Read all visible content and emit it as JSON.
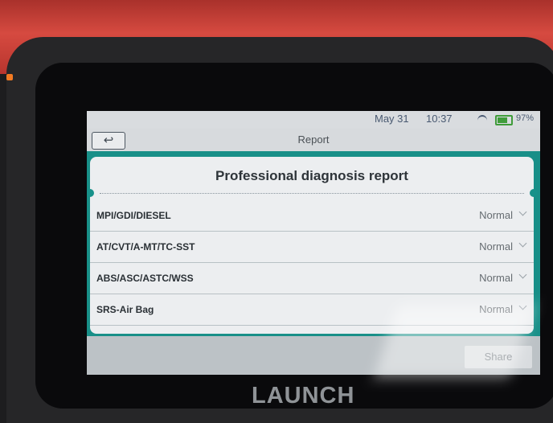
{
  "status": {
    "date": "May 31",
    "time": "10:37",
    "battery": "97%"
  },
  "header": {
    "back_icon": "back-arrow-icon",
    "title": "Report"
  },
  "report": {
    "title": "Professional diagnosis report",
    "rows": [
      {
        "label": "MPI/GDI/DIESEL",
        "value": "Normal"
      },
      {
        "label": "AT/CVT/A-MT/TC-SST",
        "value": "Normal"
      },
      {
        "label": "ABS/ASC/ASTC/WSS",
        "value": "Normal"
      },
      {
        "label": "SRS-Air Bag",
        "value": "Normal"
      }
    ]
  },
  "footer": {
    "share_label": "Share"
  },
  "device": {
    "logo": "LAUNCH"
  },
  "colors": {
    "accent": "#188f88",
    "device_red": "#d64a40"
  }
}
